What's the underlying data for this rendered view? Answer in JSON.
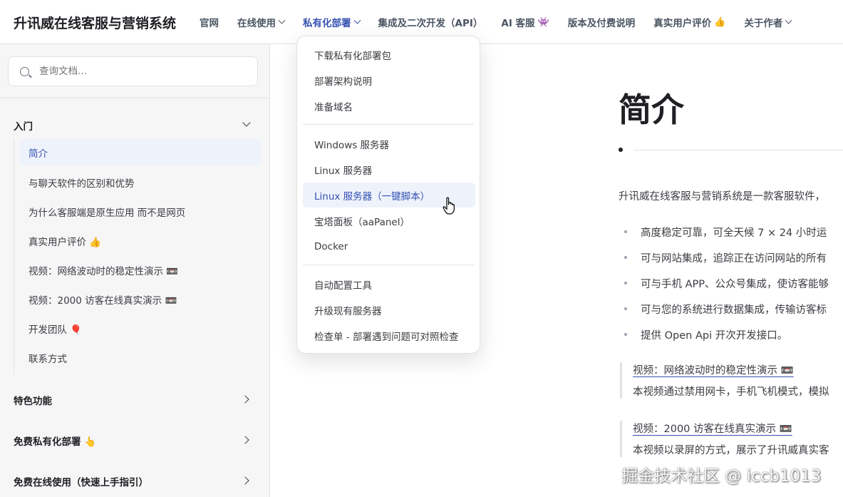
{
  "header": {
    "brand": "升讯威在线客服与营销系统",
    "nav": [
      {
        "label": "官网",
        "has_dropdown": false
      },
      {
        "label": "在线使用",
        "has_dropdown": true
      },
      {
        "label": "私有化部署",
        "has_dropdown": true,
        "active": true
      },
      {
        "label": "集成及二次开发（API）",
        "has_dropdown": false
      },
      {
        "label": "AI 客服",
        "icon": "👾",
        "has_dropdown": false
      },
      {
        "label": "版本及付费说明",
        "has_dropdown": false
      },
      {
        "label": "真实用户评价",
        "icon": "👍",
        "has_dropdown": false
      },
      {
        "label": "关于作者",
        "has_dropdown": true
      }
    ]
  },
  "sidebar": {
    "search_placeholder": "查询文档...",
    "groups": {
      "intro": {
        "title": "入门",
        "items": [
          {
            "label": "简介",
            "active": true
          },
          {
            "label": "与聊天软件的区别和优势"
          },
          {
            "label": "为什么客服端是原生应用 而不是网页"
          },
          {
            "label": "真实用户评价 👍"
          },
          {
            "label": "视频：网络波动时的稳定性演示 📼"
          },
          {
            "label": "视频：2000 访客在线真实演示 📼"
          },
          {
            "label": "开发团队 🎈"
          },
          {
            "label": "联系方式"
          }
        ]
      },
      "features": {
        "title": "特色功能"
      },
      "private": {
        "title": "免费私有化部署 👆"
      },
      "online": {
        "title": "免费在线使用（快速上手指引）"
      }
    }
  },
  "dropdown": {
    "items": [
      {
        "label": "下载私有化部署包"
      },
      {
        "label": "部署架构说明"
      },
      {
        "label": "准备域名"
      },
      {
        "label": "Windows 服务器"
      },
      {
        "label": "Linux 服务器"
      },
      {
        "label": "Linux 服务器（一键脚本）",
        "hover": true
      },
      {
        "label": "宝塔面板（aaPanel）"
      },
      {
        "label": "Docker"
      },
      {
        "label": "自动配置工具"
      },
      {
        "label": "升级现有服务器"
      },
      {
        "label": "检查单 - 部署遇到问题可对照检查"
      }
    ]
  },
  "main": {
    "title": "简介",
    "intro": "升讯威在线客服与营销系统是一款客服软件，",
    "features": [
      "高度稳定可靠，可全天候 7 × 24 小时运",
      "可与网站集成，追踪正在访问网站的所有",
      "可与手机 APP、公众号集成，使访客能够",
      "可与您的系统进行数据集成，传输访客标",
      "提供 Open Api 开次开发接口。"
    ],
    "quotes": [
      {
        "link": "视频：网络波动时的稳定性演示 📼",
        "text": "本视频通过禁用网卡，手机飞机模式，模拟"
      },
      {
        "link": "视频：2000 访客在线真实演示 📼",
        "text": "本视频以录屏的方式，展示了升讯威真实客"
      }
    ]
  },
  "watermark": "掘金技术社区 @ iccb1013",
  "colors": {
    "accent": "#3451b2",
    "hover_bg": "#eef2fb",
    "sidebar_bg": "#f6f6f7",
    "border": "#e2e2e3"
  }
}
